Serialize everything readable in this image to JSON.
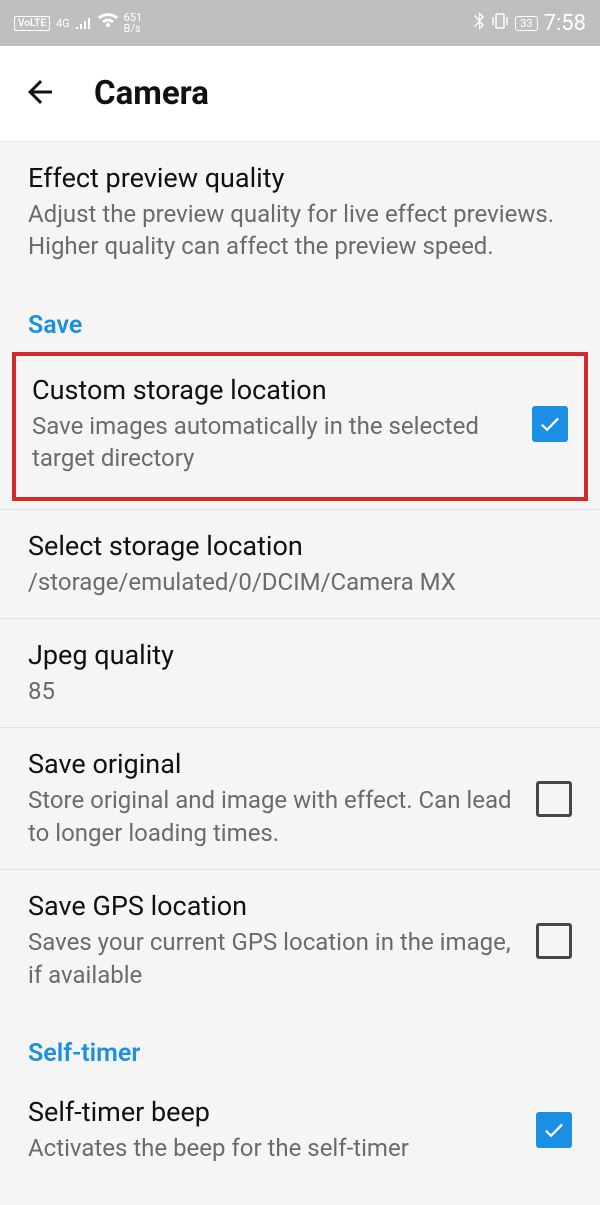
{
  "status": {
    "volte": "VoLTE",
    "gen": "4G",
    "net_top": "651",
    "net_bot": "B/s",
    "battery": "33",
    "time": "7:58"
  },
  "header": {
    "title": "Camera"
  },
  "settings": {
    "effect_preview": {
      "title": "Effect preview quality",
      "desc": "Adjust the preview quality for live effect previews. Higher quality can affect the preview speed."
    },
    "section_save": "Save",
    "custom_storage": {
      "title": "Custom storage location",
      "desc": "Save images automatically in the selected target directory",
      "checked": true
    },
    "select_storage": {
      "title": "Select storage location",
      "desc": "/storage/emulated/0/DCIM/Camera MX"
    },
    "jpeg_quality": {
      "title": "Jpeg quality",
      "desc": "85"
    },
    "save_original": {
      "title": "Save original",
      "desc": "Store original and image with effect. Can lead to longer loading times.",
      "checked": false
    },
    "save_gps": {
      "title": "Save GPS location",
      "desc": "Saves your current GPS location in the image, if available",
      "checked": false
    },
    "section_selftimer": "Self-timer",
    "selftimer_beep": {
      "title": "Self-timer beep",
      "desc": "Activates the beep for the self-timer",
      "checked": true
    }
  }
}
